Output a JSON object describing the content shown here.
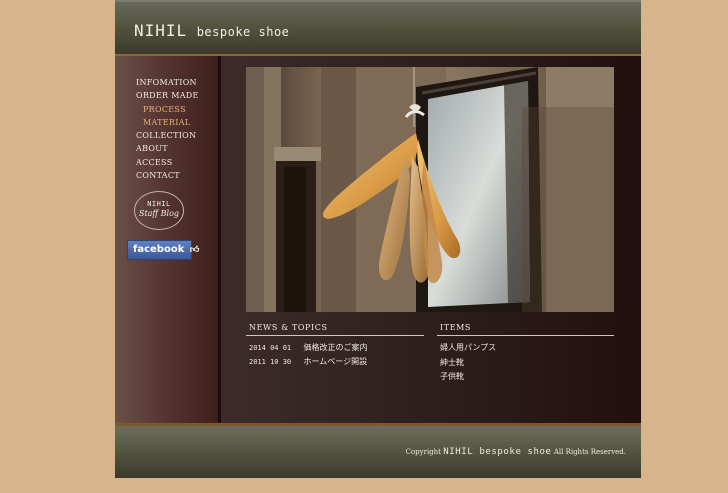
{
  "header": {
    "brand": "NIHIL",
    "subtitle": "bespoke shoe"
  },
  "nav": {
    "items": [
      {
        "label": "INFOMATION"
      },
      {
        "label": "ORDER MADE"
      },
      {
        "label": "PROCESS"
      },
      {
        "label": "MATERIAL"
      },
      {
        "label": "COLLECTION"
      },
      {
        "label": "ABOUT"
      },
      {
        "label": "ACCESS"
      },
      {
        "label": "CONTACT"
      }
    ]
  },
  "blog": {
    "line1": "NIHIL",
    "line2": "Staff Blog"
  },
  "facebook": {
    "label": "facebook",
    "icon": "thumbs-up-icon"
  },
  "hero": {
    "subject": "wooden shoe lasts hanging by a window"
  },
  "news": {
    "heading": "NEWS & TOPICS",
    "entries": [
      {
        "date": "2014 04 01",
        "title": "価格改正のご案内"
      },
      {
        "date": "2011 10 30",
        "title": "ホームページ開設"
      }
    ]
  },
  "items": {
    "heading": "ITEMS",
    "entries": [
      {
        "label": "婦人用パンプス"
      },
      {
        "label": "紳士靴"
      },
      {
        "label": "子供靴"
      }
    ]
  },
  "footer": {
    "prefix": "Copyright",
    "brand": "NIHIL bespoke shoe",
    "suffix": "All Rights Reserved."
  },
  "colors": {
    "background": "#d7b58c",
    "header": "#55543f",
    "content": "#2a1614",
    "accent": "#e7b07a",
    "facebook": "#3b5998"
  }
}
